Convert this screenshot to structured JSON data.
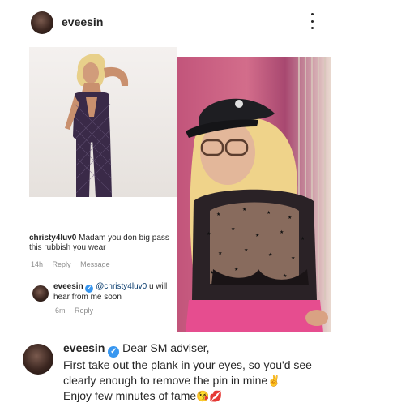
{
  "post": {
    "username": "eveesin"
  },
  "comments": [
    {
      "username": "christy4luv0",
      "text": "Madam you don big pass this rubbish you wear",
      "time": "14h",
      "reply_label": "Reply",
      "message_label": "Message"
    },
    {
      "username": "eveesin",
      "verified": true,
      "mention": "@christy4luv0",
      "text": "u will hear from me soon",
      "time": "6m",
      "reply_label": "Reply"
    }
  ],
  "caption": {
    "username": "eveesin",
    "verified": true,
    "line1": "Dear SM adviser,",
    "line2": "First take out the plank in your eyes, so you'd see",
    "line3": "clearly enough to remove the pin in mine",
    "line3_emoji": "✌️",
    "line4": "Enjoy few minutes of fame",
    "line4_emoji": "😘💋"
  },
  "icons": {
    "avatar": "profile-photo",
    "more": "more-options-icon",
    "verified": "verified-badge-icon"
  },
  "colors": {
    "verified": "#3897f0",
    "meta": "#8e8e8e",
    "mention": "#003569"
  }
}
